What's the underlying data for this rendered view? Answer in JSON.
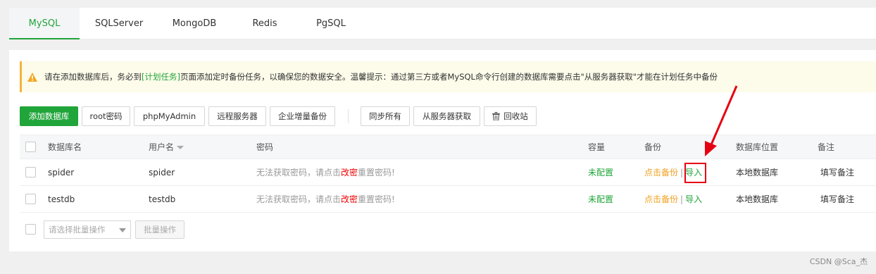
{
  "tabs": [
    "MySQL",
    "SQLServer",
    "MongoDB",
    "Redis",
    "PgSQL"
  ],
  "notice": {
    "prefix": "请在添加数据库后，务必到",
    "link": "[计划任务]",
    "suffix": "页面添加定时备份任务，以确保您的数据安全。温馨提示：通过第三方或者MySQL命令行创建的数据库需要点击\"从服务器获取\"才能在计划任务中备份"
  },
  "toolbar": {
    "add_db": "添加数据库",
    "root_pwd": "root密码",
    "phpmyadmin": "phpMyAdmin",
    "remote_server": "远程服务器",
    "enterprise_backup": "企业增量备份",
    "sync_all": "同步所有",
    "get_from_server": "从服务器获取",
    "recycle_bin": "回收站"
  },
  "table": {
    "headers": {
      "name": "数据库名",
      "user": "用户名",
      "password": "密码",
      "capacity": "容量",
      "backup": "备份",
      "location": "数据库位置",
      "remark": "备注"
    },
    "rows": [
      {
        "name": "spider",
        "user": "spider",
        "pwd_prefix": "无法获取密码，请点击",
        "pwd_link": "改密",
        "pwd_suffix": "重置密码!",
        "capacity": "未配置",
        "backup": "点击备份",
        "import": "导入",
        "location": "本地数据库",
        "remark": "填写备注"
      },
      {
        "name": "testdb",
        "user": "testdb",
        "pwd_prefix": "无法获取密码，请点击",
        "pwd_link": "改密",
        "pwd_suffix": "重置密码!",
        "capacity": "未配置",
        "backup": "点击备份",
        "import": "导入",
        "location": "本地数据库",
        "remark": "填写备注"
      }
    ]
  },
  "batch": {
    "placeholder": "请选择批量操作",
    "button": "批量操作"
  },
  "watermark": "CSDN @Sca_杰",
  "colors": {
    "accent": "#20a53a",
    "warning": "#f0a020",
    "danger": "#e00000",
    "annotation": "#e60012"
  }
}
